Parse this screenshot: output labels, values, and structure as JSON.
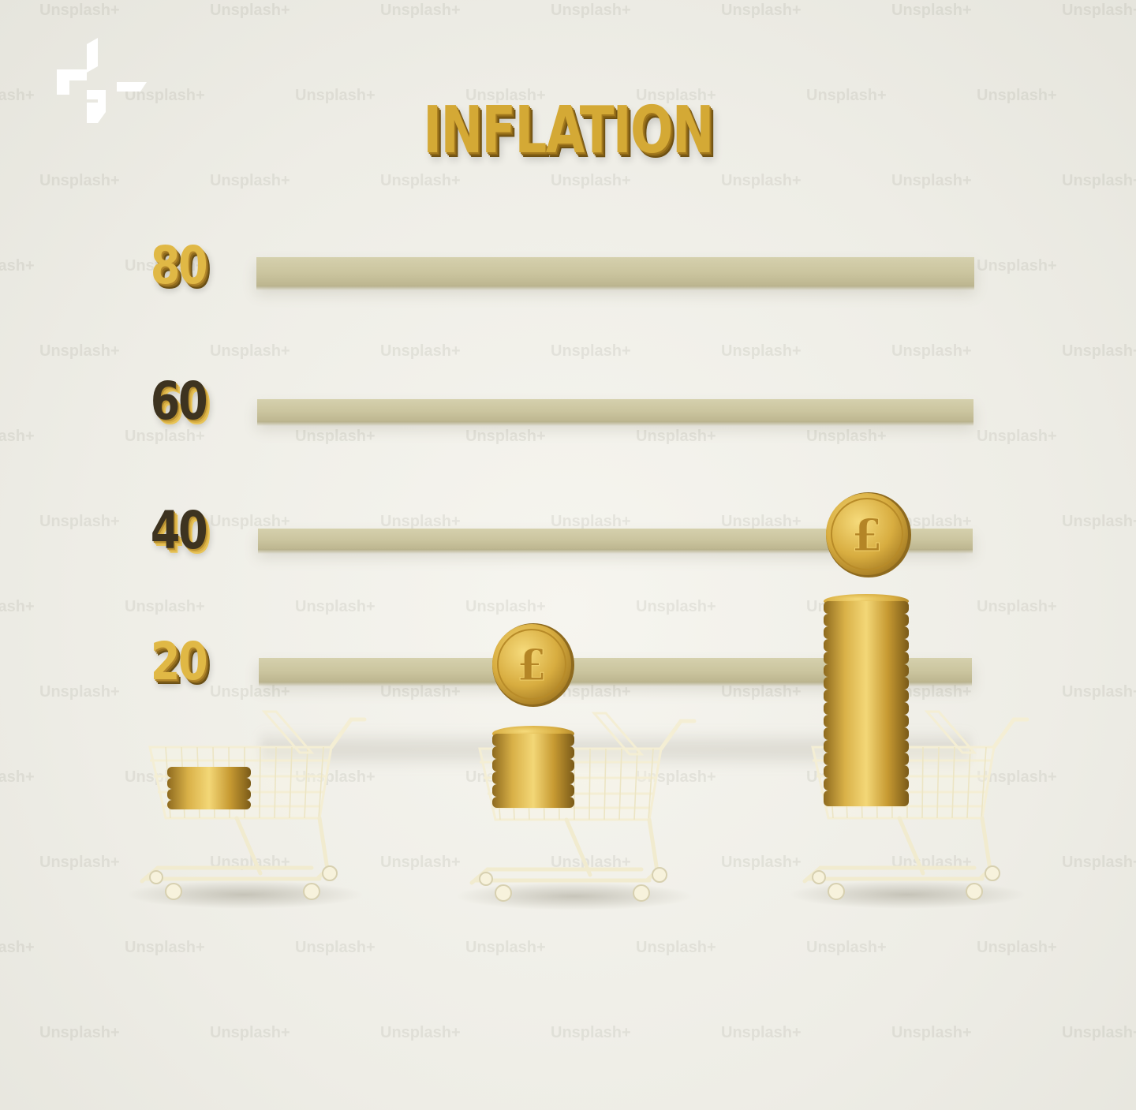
{
  "title": "INFLATION",
  "watermark_text": "Unsplash+",
  "y_labels": [
    {
      "value": "80",
      "style": "gold"
    },
    {
      "value": "60",
      "style": "dark"
    },
    {
      "value": "40",
      "style": "dark"
    },
    {
      "value": "20",
      "style": "gold"
    }
  ],
  "coin_symbol": "£",
  "colors": {
    "gold": "#d4a935",
    "shelf": "#cfc9a3",
    "background": "#f0efe8",
    "cart": "#f2ecd2"
  },
  "icons": [
    "unsplash-plus-logo",
    "pound-coin-icon",
    "shopping-cart-icon"
  ]
}
